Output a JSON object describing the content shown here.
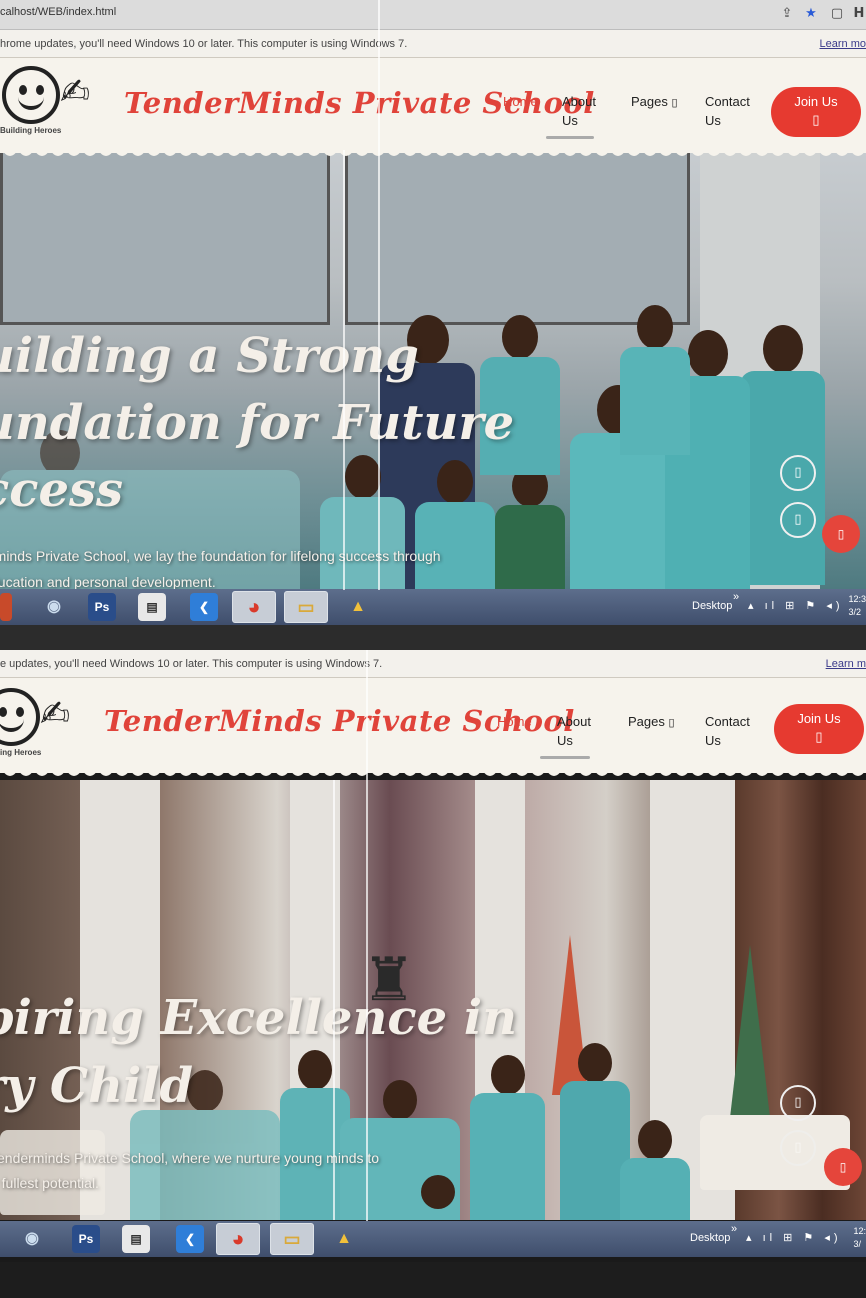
{
  "browser": {
    "url": "calhost/WEB/index.html",
    "share_icon": "share-icon",
    "star_icon": "star-icon",
    "window_icon": "window-icon",
    "avatar_letter": "H"
  },
  "update_notice": {
    "text_top": "hrome updates, you'll need Windows 10 or later. This computer is using Windows 7.",
    "text_bottom": "e updates, you'll need Windows 10 or later. This computer is using Windows 7.",
    "learn_more_top": "Learn mo",
    "learn_more_bottom": "Learn m"
  },
  "site": {
    "brand": "TenderMinds Private School",
    "tagline_top": "Building Heroes",
    "tagline_bottom": "ing Heroes",
    "nav": {
      "home": "Home",
      "about_1": "About",
      "about_2": "Us",
      "pages": "Pages",
      "contact_1": "Contact",
      "contact_2": "Us",
      "join": "Join Us",
      "box_glyph": "▯"
    },
    "accent_color": "#e0433a",
    "join_color": "#e63a30"
  },
  "slides": [
    {
      "title_line1": "uilding a Strong",
      "title_line2": "undation for Future",
      "title_line3": "ccess",
      "subtitle_line1": "rminds Private School, we lay the foundation for lifelong success through",
      "subtitle_line2": "ducation and personal development."
    },
    {
      "title_line1": "piring Excellence in",
      "title_line2": "ry Child",
      "subtitle_line1": "Tenderminds Private School, where we nurture young minds to",
      "subtitle_line2": "ir fullest potential."
    }
  ],
  "taskbar": {
    "ps_label": "Ps",
    "desktop_label": "Desktop",
    "chevron": "»",
    "tray": "▴ ıl ⊞ ⚑ ◂)",
    "clock_top_1": "12:3",
    "clock_top_2": "3/2",
    "clock_bottom_1": "12:",
    "clock_bottom_2": "3/"
  }
}
